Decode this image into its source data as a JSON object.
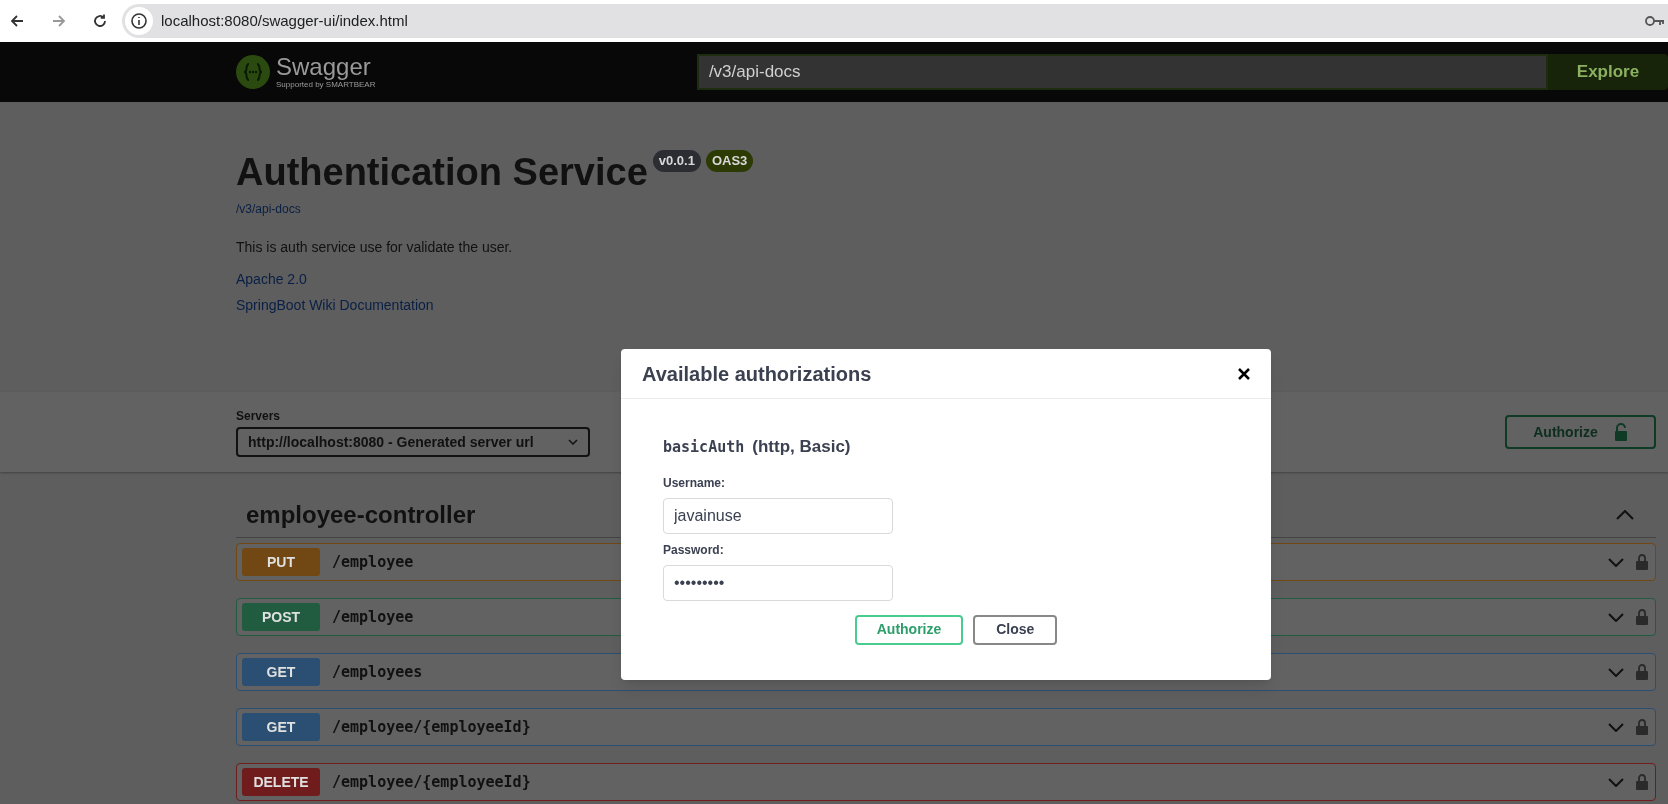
{
  "browser": {
    "url": "localhost:8080/swagger-ui/index.html"
  },
  "topbar": {
    "brand": "Swagger",
    "tagline": "Supported by SMARTBEAR",
    "url_value": "/v3/api-docs",
    "explore": "Explore"
  },
  "info": {
    "title": "Authentication Service",
    "badges": [
      {
        "label": "v0.0.1",
        "color": "#2b2d33"
      },
      {
        "label": "OAS3",
        "color": "#2c3b03"
      }
    ],
    "spec_link": "/v3/api-docs",
    "description": "This is auth service use for validate the user.",
    "links": [
      "Apache 2.0",
      "SpringBoot Wiki Documentation"
    ]
  },
  "servers": {
    "label": "Servers",
    "value": "http://localhost:8080 - Generated server url"
  },
  "authorize_button": "Authorize",
  "tag": {
    "name": "employee-controller",
    "expanded": true
  },
  "operations": [
    {
      "method": "PUT",
      "path": "/employee",
      "color": "#714813"
    },
    {
      "method": "POST",
      "path": "/employee",
      "color": "#215c41"
    },
    {
      "method": "GET",
      "path": "/employees",
      "color": "#2b4f72"
    },
    {
      "method": "GET",
      "path": "/employee/{employeeId}",
      "color": "#2b4f72"
    },
    {
      "method": "DELETE",
      "path": "/employee/{employeeId}",
      "color": "#701c1c"
    }
  ],
  "modal": {
    "title": "Available authorizations",
    "scheme_name": "basicAuth",
    "scheme_type": "(http, Basic)",
    "fields": [
      {
        "label": "Username:",
        "value": "javainuse"
      },
      {
        "label": "Password:",
        "value": "•••••••••"
      }
    ],
    "buttons": [
      {
        "label": "Authorize",
        "kind": "primary"
      },
      {
        "label": "Close",
        "kind": "secondary"
      }
    ]
  }
}
